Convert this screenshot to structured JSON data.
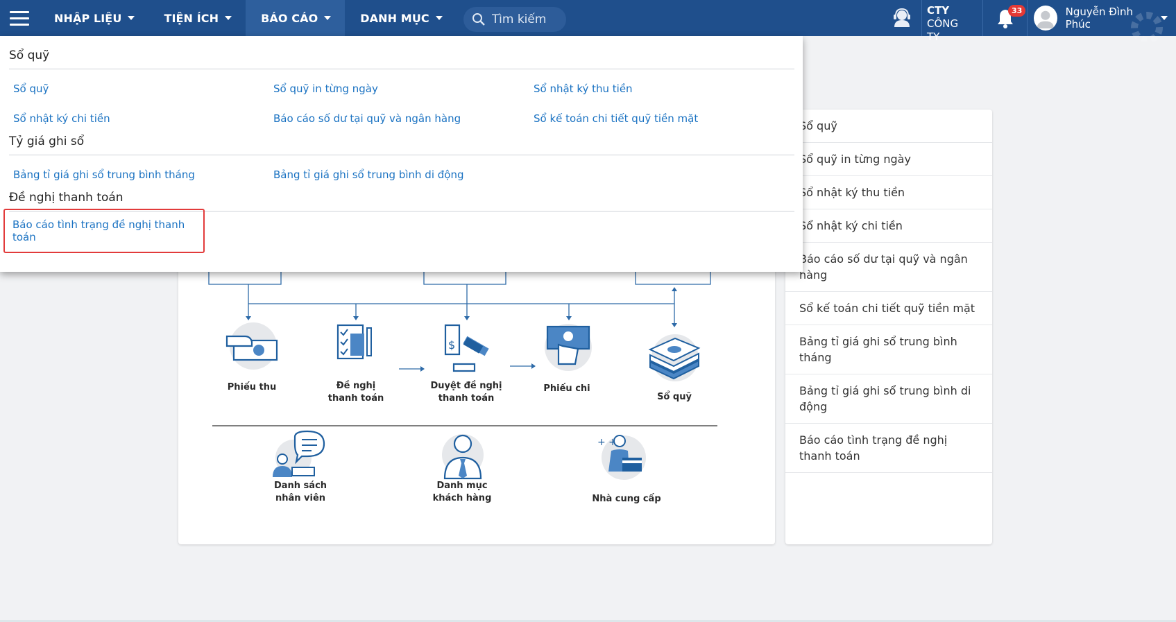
{
  "nav": {
    "menu": [
      {
        "label": "NHẬP LIỆU"
      },
      {
        "label": "TIỆN ÍCH"
      },
      {
        "label": "BÁO CÁO"
      },
      {
        "label": "DANH MỤC"
      }
    ],
    "search_placeholder": "Tìm kiếm",
    "company_line1": "CTY",
    "company_line2": "CÔNG TY",
    "notification_count": "33",
    "user_name": "Nguyễn Đình Phúc"
  },
  "dropdown": {
    "sections": [
      {
        "title": "Sổ quỹ",
        "links": [
          "Sổ quỹ",
          "Sổ quỹ in từng ngày",
          "Sổ nhật ký thu tiền",
          "Sổ nhật ký chi tiền",
          "Báo cáo số dư tại quỹ và ngân hàng",
          "Sổ kế toán chi tiết quỹ tiền mặt"
        ]
      },
      {
        "title": "Tỷ giá ghi sổ",
        "links": [
          "Bảng tỉ giá ghi sổ trung bình tháng",
          "Bảng tỉ giá ghi sổ trung bình di động"
        ]
      },
      {
        "title": "Đề nghị thanh toán",
        "links": [
          "Báo cáo tình trạng đề nghị thanh toán"
        ]
      }
    ]
  },
  "diagram": {
    "steps": [
      "Phiếu thu",
      "Đề nghị thanh toán",
      "Duyệt đề nghị thanh toán",
      "Phiếu chi",
      "Sổ quỹ"
    ],
    "categories": [
      "Danh sách nhân viên",
      "Danh mục khách hàng",
      "Nhà cung cấp"
    ]
  },
  "sidebar": {
    "items": [
      "Sổ quỹ",
      "Sổ quỹ in từng ngày",
      "Sổ nhật ký thu tiền",
      "Sổ nhật ký chi tiền",
      "Báo cáo số dư tại quỹ và ngân hàng",
      "Sổ kế toán chi tiết quỹ tiền mặt",
      "Bảng tỉ giá ghi sổ trung bình tháng",
      "Bảng tỉ giá ghi sổ trung bình di động",
      "Báo cáo tình trạng đề nghị thanh toán"
    ]
  },
  "colors": {
    "navbar": "#1f4f8c",
    "link": "#1a72c2",
    "highlight_border": "#e23b3b",
    "icon_blue": "#1f5f9f"
  },
  "icons": [
    "hamburger-icon",
    "search-icon",
    "support-icon",
    "bell-icon",
    "user-avatar-icon",
    "gear-icon"
  ]
}
